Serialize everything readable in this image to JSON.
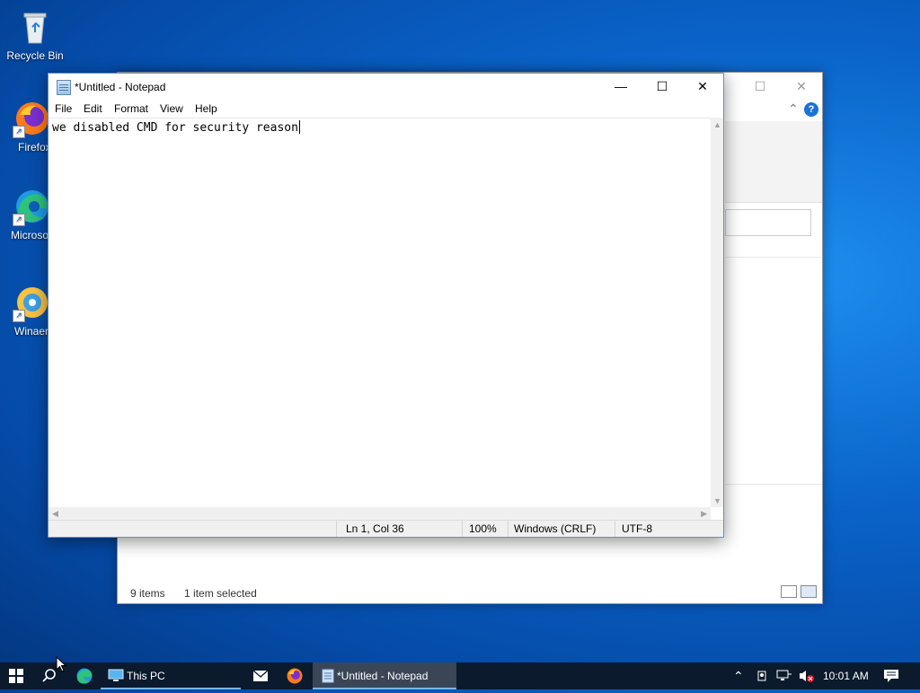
{
  "desktop": {
    "icons": [
      {
        "label": "Recycle Bin"
      },
      {
        "label": "Firefox"
      },
      {
        "label": "Microsoft Edge"
      },
      {
        "label": "Winaero Tweaker"
      }
    ]
  },
  "explorer": {
    "status_items": "9 items",
    "status_selected": "1 item selected",
    "maximize_glyph": "☐",
    "close_glyph": "✕",
    "help_glyph": "?",
    "collapse_glyph": "⌃"
  },
  "notepad": {
    "title": "*Untitled - Notepad",
    "menu": [
      "File",
      "Edit",
      "Format",
      "View",
      "Help"
    ],
    "content": "we disabled CMD for security reason",
    "status": {
      "position": "Ln 1, Col 36",
      "zoom": "100%",
      "line_ending": "Windows (CRLF)",
      "encoding": "UTF-8"
    },
    "controls": {
      "minimize": "—",
      "maximize": "☐",
      "close": "✕"
    }
  },
  "taskbar": {
    "this_pc": "This PC",
    "notepad": "*Untitled - Notepad",
    "time": "10:01 AM"
  },
  "colors": {
    "accent": "#77b6ea",
    "taskbar": "#0b1a2c"
  }
}
